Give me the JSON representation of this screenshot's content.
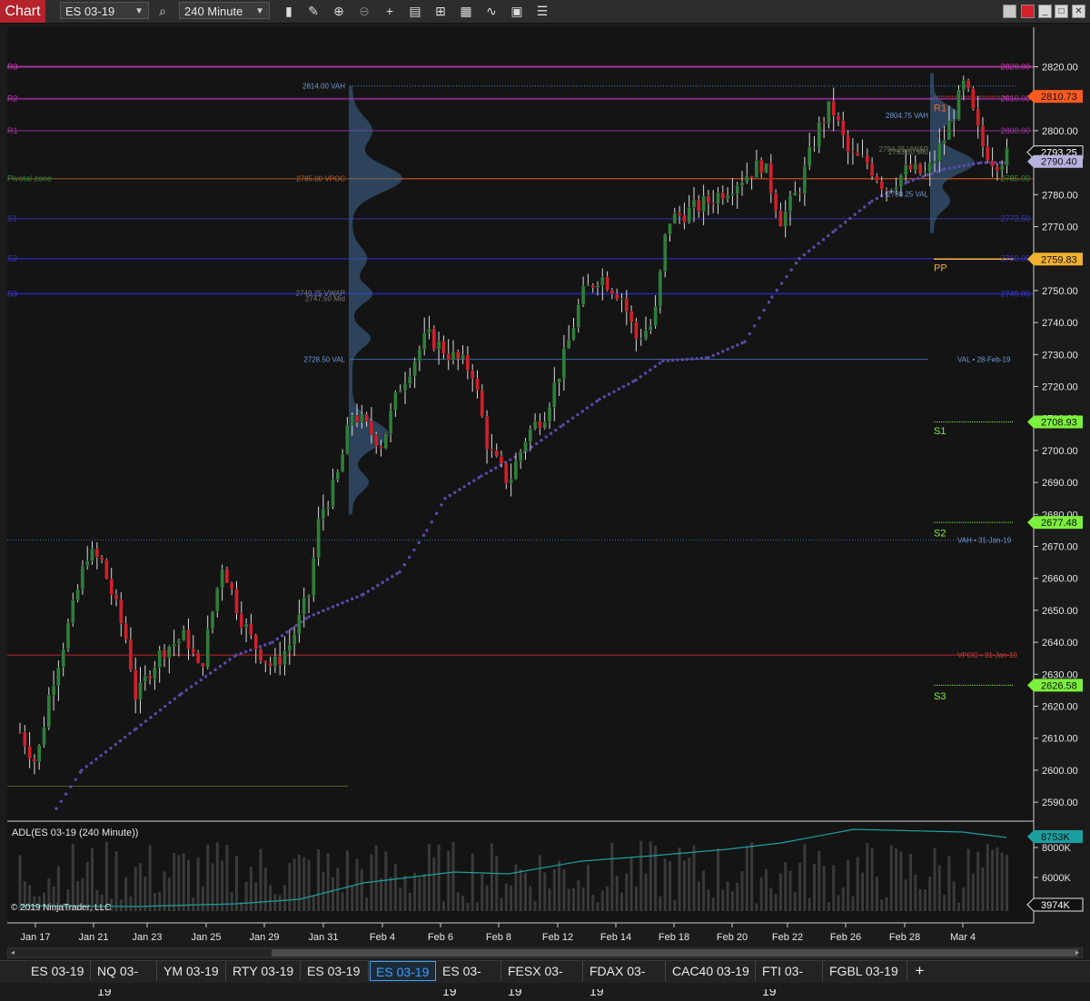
{
  "toolbar": {
    "chart_label": "Chart",
    "instrument": "ES 03-19",
    "interval": "240 Minute",
    "icons": [
      "search-icon",
      "bar-type-icon",
      "draw-icon",
      "zoom-in-icon",
      "zoom-out-icon",
      "crosshair-icon",
      "data-box-icon",
      "indicators-icon",
      "strategies-icon",
      "templates-icon",
      "properties-icon",
      "chart-trader-icon"
    ],
    "window_buttons": [
      "color-icon",
      "close-icon",
      "minimize-icon",
      "maximize-icon",
      "close-window-icon"
    ]
  },
  "chart": {
    "watermark": "© 2019 NinjaTrader, LLC",
    "price_ticks": [
      "2820.00",
      "2810.00",
      "2800.00",
      "2790.00",
      "2780.00",
      "2770.00",
      "2760.00",
      "2750.00",
      "2740.00",
      "2730.00",
      "2720.00",
      "2710.00",
      "2700.00",
      "2690.00",
      "2680.00",
      "2670.00",
      "2660.00",
      "2650.00",
      "2640.00",
      "2630.00",
      "2620.00",
      "2610.00",
      "2600.00",
      "2590.00"
    ],
    "date_ticks": [
      "Jan 17",
      "Jan 21",
      "Jan 23",
      "Jan 25",
      "Jan 29",
      "Jan 31",
      "Feb 4",
      "Feb 6",
      "Feb 8",
      "Feb 12",
      "Feb 14",
      "Feb 18",
      "Feb 20",
      "Feb 22",
      "Feb 26",
      "Feb 28",
      "Mar 4"
    ],
    "axis_badges": [
      {
        "label": "2810.73",
        "color": "#ff5a1f"
      },
      {
        "label": "2793.25",
        "color": "#111111"
      },
      {
        "label": "2790.40",
        "color": "#b7b3e0"
      },
      {
        "label": "2759.83",
        "color": "#f0b030"
      },
      {
        "label": "2708.93",
        "color": "#7cf03c"
      },
      {
        "label": "2677.48",
        "color": "#7cf03c"
      },
      {
        "label": "2626.58",
        "color": "#7cf03c"
      }
    ],
    "pivot_left_labels": [
      "R3",
      "R2",
      "R1",
      "Pivotal zone",
      "S1",
      "S2",
      "S3"
    ],
    "level_labels": [
      "2820.00",
      "2810.00",
      "2800.00",
      "2785.00",
      "2772.50",
      "2760.00",
      "2749.00"
    ],
    "pivot_right_labels": [
      "R1",
      "PP",
      "S1",
      "S2",
      "S3"
    ],
    "profile_labels": [
      "2814.00 VAH",
      "2785.00 VPOC",
      "2749.25 VWAP",
      "2747.50 Mid",
      "2728.50 VAL"
    ],
    "recent_profile_labels": [
      "2804.75 VAH",
      "2794.25 VWAP",
      "2793.50 Mid",
      "2780.25 VAL"
    ],
    "naked_level_labels": [
      "VAL • 28-Feb-19",
      "VAH • 31-Jan-19",
      "VPOC • 31-Jan-19"
    ]
  },
  "indicator": {
    "title": "ADL(ES 03-19 (240 Minute))",
    "ticks": [
      "8000K",
      "6000K",
      "4000K"
    ],
    "badge_top": "8753K",
    "badge_bottom": "3974K"
  },
  "scrollbar": {
    "left_arrow": "◂",
    "right_arrow": "▸"
  },
  "tabs": [
    {
      "label": "ES 03-19"
    },
    {
      "label": "NQ 03-19"
    },
    {
      "label": "YM 03-19"
    },
    {
      "label": "RTY 03-19"
    },
    {
      "label": "ES 03-19"
    },
    {
      "label": "ES 03-19",
      "active": true
    },
    {
      "label": "ES 03-19"
    },
    {
      "label": "FESX 03-19"
    },
    {
      "label": "FDAX 03-19"
    },
    {
      "label": "CAC40 03-19"
    },
    {
      "label": "FTI 03-19"
    },
    {
      "label": "FGBL 03-19"
    }
  ],
  "add_tab": "+"
}
